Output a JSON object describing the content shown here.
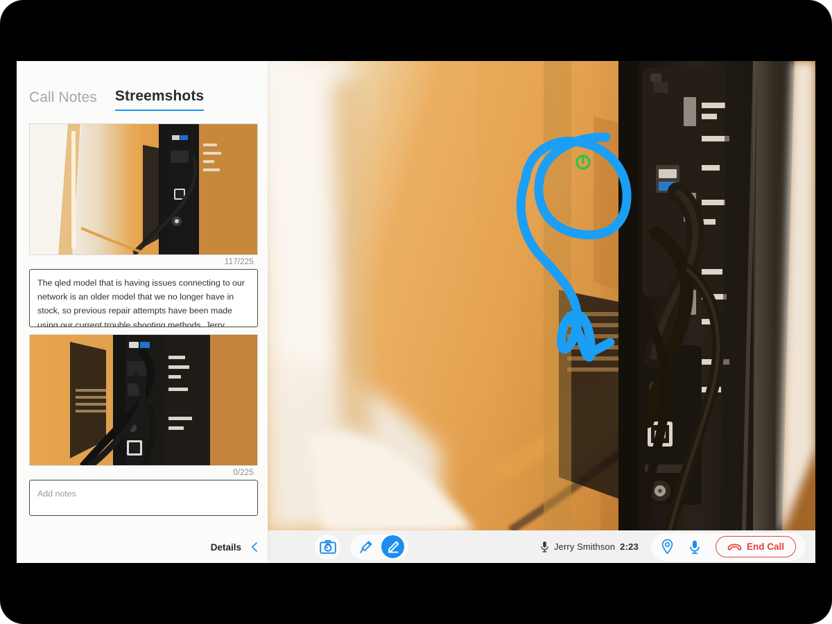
{
  "app": {
    "accent_blue": "#1b8df0",
    "danger_red": "#e8413c",
    "sidebar_bg": "#fbfbfa"
  },
  "sidebar": {
    "tabs": [
      {
        "label": "Call Notes",
        "active": false
      },
      {
        "label": "Streemshots",
        "active": true
      }
    ],
    "shots": [
      {
        "image_name": "tv-back-panel-wide-shot",
        "counter": "117/225",
        "note": "The qled model that is having issues connecting to our network is an older model that we no longer have in stock, so previous repair attempts have been made using our current trouble shooting methods. Jerry reached out in January for cable connectivity issues, so the hardware on the third row"
      },
      {
        "image_name": "tv-back-panel-close-shot",
        "counter": "0/225",
        "note": "",
        "note_placeholder": "Add notes"
      }
    ],
    "details": {
      "label": "Details",
      "collapse_icon": "chevron-left-icon"
    }
  },
  "stage": {
    "video_alt": "Live video of a TV rear panel with USB, HDMI, ethernet and coax ports, cables plugged in, orange wall behind",
    "annotation": {
      "color": "#1b9ef5",
      "shapes": [
        "circle-around-usb-ports",
        "curved-arrow-pointing-down"
      ]
    },
    "indicator": {
      "name": "green-power-indicator",
      "color": "#29c24a"
    }
  },
  "controls": {
    "capture": {
      "label": "",
      "icon": "camera-icon"
    },
    "pointer": {
      "label": "",
      "icon": "laser-pointer-icon"
    },
    "draw": {
      "label": "",
      "icon": "pen-icon",
      "active": true
    },
    "speaker": {
      "mic_icon": "microphone-icon",
      "name": "Jerry Smithson",
      "timer": "2:23"
    },
    "location": {
      "icon": "location-pin-icon"
    },
    "mic": {
      "icon": "microphone-icon"
    },
    "end_call": {
      "label": "End Call",
      "icon": "phone-hangup-icon"
    }
  }
}
